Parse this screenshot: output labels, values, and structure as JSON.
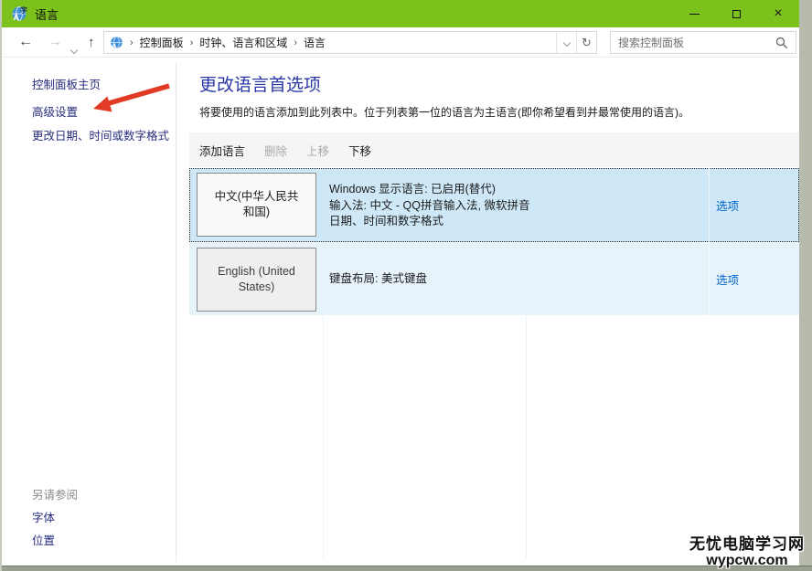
{
  "window": {
    "title": "语言",
    "controls": {
      "minimize": "minimize",
      "maximize": "maximize",
      "close": "×"
    }
  },
  "navbar": {
    "breadcrumb": [
      "控制面板",
      "时钟、语言和区域",
      "语言"
    ],
    "search_placeholder": "搜索控制面板"
  },
  "sidebar": {
    "items": [
      "控制面板主页",
      "高级设置",
      "更改日期、时间或数字格式"
    ],
    "see_also": {
      "header": "另请参阅",
      "items": [
        "字体",
        "位置"
      ]
    }
  },
  "main": {
    "title": "更改语言首选项",
    "description": "将要使用的语言添加到此列表中。位于列表第一位的语言为主语言(即你希望看到并最常使用的语言)。",
    "toolbar": [
      {
        "label": "添加语言",
        "enabled": true
      },
      {
        "label": "删除",
        "enabled": false
      },
      {
        "label": "上移",
        "enabled": false
      },
      {
        "label": "下移",
        "enabled": true
      }
    ],
    "languages": [
      {
        "name": "中文(中华人民共和国)",
        "details": [
          "Windows 显示语言: 已启用(替代)",
          "输入法: 中文 - QQ拼音输入法, 微软拼音",
          "日期、时间和数字格式"
        ],
        "options_label": "选项",
        "selected": true
      },
      {
        "name": "English (United States)",
        "details": [
          "键盘布局: 美式键盘"
        ],
        "options_label": "选项",
        "selected": false
      }
    ]
  },
  "watermark": {
    "line1": "无忧电脑学习网",
    "line2": "wypcw.com"
  },
  "colors": {
    "titlebar_green": "#7cc21c",
    "selected_row_blue": "#cfe8f7",
    "alt_row_blue": "#e7f3fb",
    "link_blue": "#0066cc",
    "sidebar_navy": "#262d7e",
    "heading_blue": "#2936a6",
    "annotation_arrow_red": "#e23b25"
  }
}
